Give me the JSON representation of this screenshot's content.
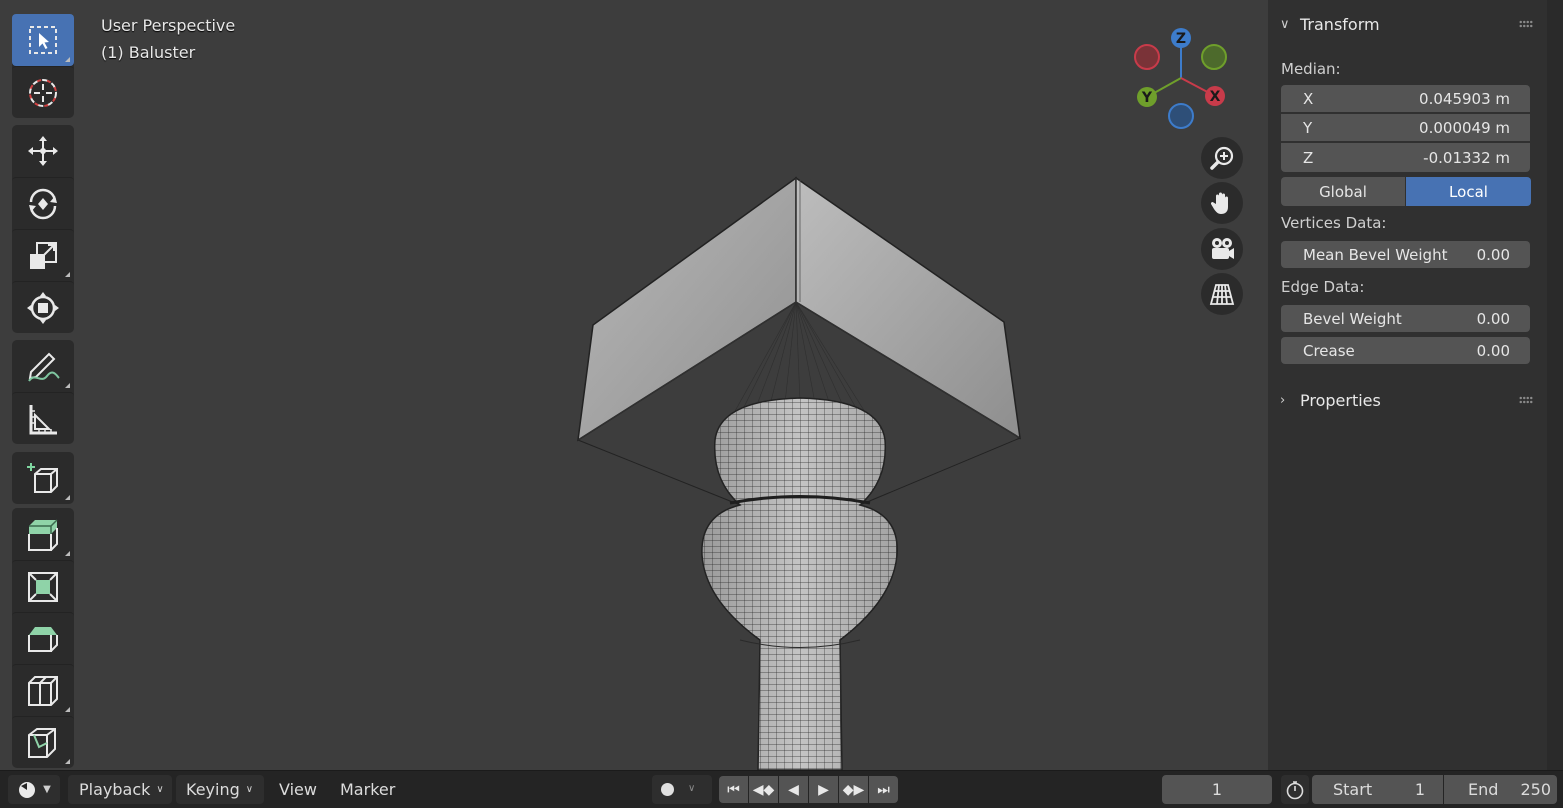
{
  "viewport": {
    "title": "User Perspective",
    "object_name": "(1) Baluster"
  },
  "toolbar": {
    "tools": [
      {
        "name": "select-box-icon",
        "active": true
      },
      {
        "name": "cursor-icon",
        "active": false
      },
      {
        "name": "move-icon",
        "active": false
      },
      {
        "name": "rotate-icon",
        "active": false
      },
      {
        "name": "scale-icon",
        "active": false
      },
      {
        "name": "transform-icon",
        "active": false
      },
      {
        "name": "annotate-icon",
        "active": false
      },
      {
        "name": "measure-icon",
        "active": false
      },
      {
        "name": "add-cube-icon",
        "active": false
      },
      {
        "name": "extrude-region-icon",
        "active": false
      },
      {
        "name": "inset-faces-icon",
        "active": false
      },
      {
        "name": "bevel-icon",
        "active": false
      },
      {
        "name": "loop-cut-icon",
        "active": false
      },
      {
        "name": "knife-icon",
        "active": false
      }
    ]
  },
  "gizmo": {
    "axes": {
      "z": "Z",
      "y": "Y",
      "x": "X"
    },
    "colors": {
      "x": "#c83b4a",
      "y": "#6f9f2b",
      "z": "#3d7ccb"
    }
  },
  "nav_buttons": [
    "zoom-icon",
    "pan-hand-icon",
    "camera-icon",
    "perspective-grid-icon"
  ],
  "panel": {
    "transform": {
      "header": "Transform",
      "median_label": "Median:",
      "x": {
        "label": "X",
        "value": "0.045903 m"
      },
      "y": {
        "label": "Y",
        "value": "0.000049 m"
      },
      "z": {
        "label": "Z",
        "value": "-0.01332 m"
      },
      "space": {
        "global": "Global",
        "local": "Local",
        "selected": "Local"
      },
      "vertices_label": "Vertices Data:",
      "mean_bevel": {
        "label": "Mean Bevel Weight",
        "value": "0.00"
      },
      "edge_label": "Edge Data:",
      "bevel_weight": {
        "label": "Bevel Weight",
        "value": "0.00"
      },
      "crease": {
        "label": "Crease",
        "value": "0.00"
      }
    },
    "properties": {
      "header": "Properties"
    }
  },
  "timeline": {
    "menus": {
      "playback": "Playback",
      "keying": "Keying",
      "view": "View",
      "marker": "Marker"
    },
    "current_frame": "1",
    "start": {
      "label": "Start",
      "value": "1"
    },
    "end": {
      "label": "End",
      "value": "250"
    }
  },
  "colors": {
    "accent": "#4772b3",
    "background": "#3d3d3d",
    "panel": "#303030"
  }
}
